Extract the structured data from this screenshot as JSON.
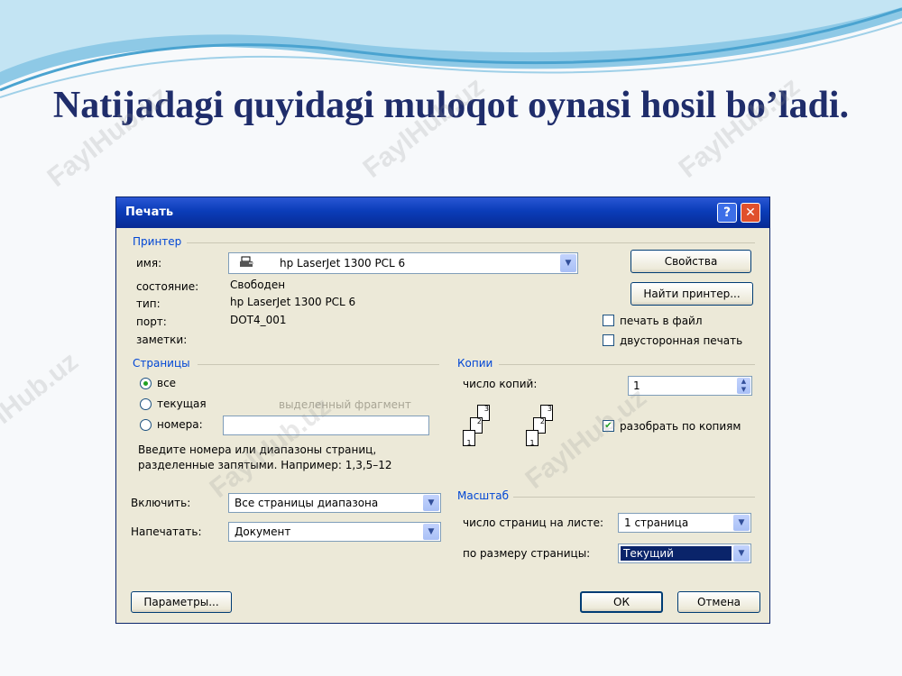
{
  "slide": {
    "title": "Natijadagi quyidagi muloqot oynasi hosil bo’ladi."
  },
  "watermark": "FaylHub.uz",
  "dialog": {
    "title": "Печать",
    "printer": {
      "group_label": "Принтер",
      "name_label": "имя:",
      "name_value": "hp LaserJet 1300 PCL 6",
      "status_label": "состояние:",
      "status_value": "Свободен",
      "type_label": "тип:",
      "type_value": "hp LaserJet 1300 PCL 6",
      "port_label": "порт:",
      "port_value": "DOT4_001",
      "notes_label": "заметки:",
      "properties_button": "Свойства",
      "find_printer_button": "Найти принтер...",
      "print_to_file_label": "печать в файл",
      "print_to_file_checked": false,
      "duplex_label": "двусторонная печать",
      "duplex_checked": false
    },
    "pages": {
      "group_label": "Страницы",
      "all_label": "все",
      "current_label": "текущая",
      "selection_label": "выделенный фрагмент",
      "numbers_label": "номера:",
      "numbers_value": "",
      "selected_option": "все",
      "hint": "Введите номера или диапазоны страниц, разделенные запятыми. Например: 1,3,5–12"
    },
    "copies": {
      "group_label": "Копии",
      "count_label": "число копий:",
      "count_value": "1",
      "collate_label": "разобрать по копиям",
      "collate_checked": true,
      "stack_pages": [
        "1",
        "2",
        "3"
      ]
    },
    "include": {
      "label": "Включить:",
      "value": "Все страницы диапазона"
    },
    "print_what": {
      "label": "Напечатать:",
      "value": "Документ"
    },
    "scale": {
      "group_label": "Масштаб",
      "pages_per_sheet_label": "число страниц на листе:",
      "pages_per_sheet_value": "1 страница",
      "fit_to_label": "по размеру страницы:",
      "fit_to_value": "Текущий"
    },
    "options_button": "Параметры...",
    "ok_button": "ОК",
    "cancel_button": "Отмена"
  },
  "colors": {
    "title_text": "#1f2d6b",
    "titlebar": "#0a3cb8",
    "dialog_bg": "#ece9d8",
    "group_label": "#0046d5",
    "highlight": "#0a246a"
  }
}
